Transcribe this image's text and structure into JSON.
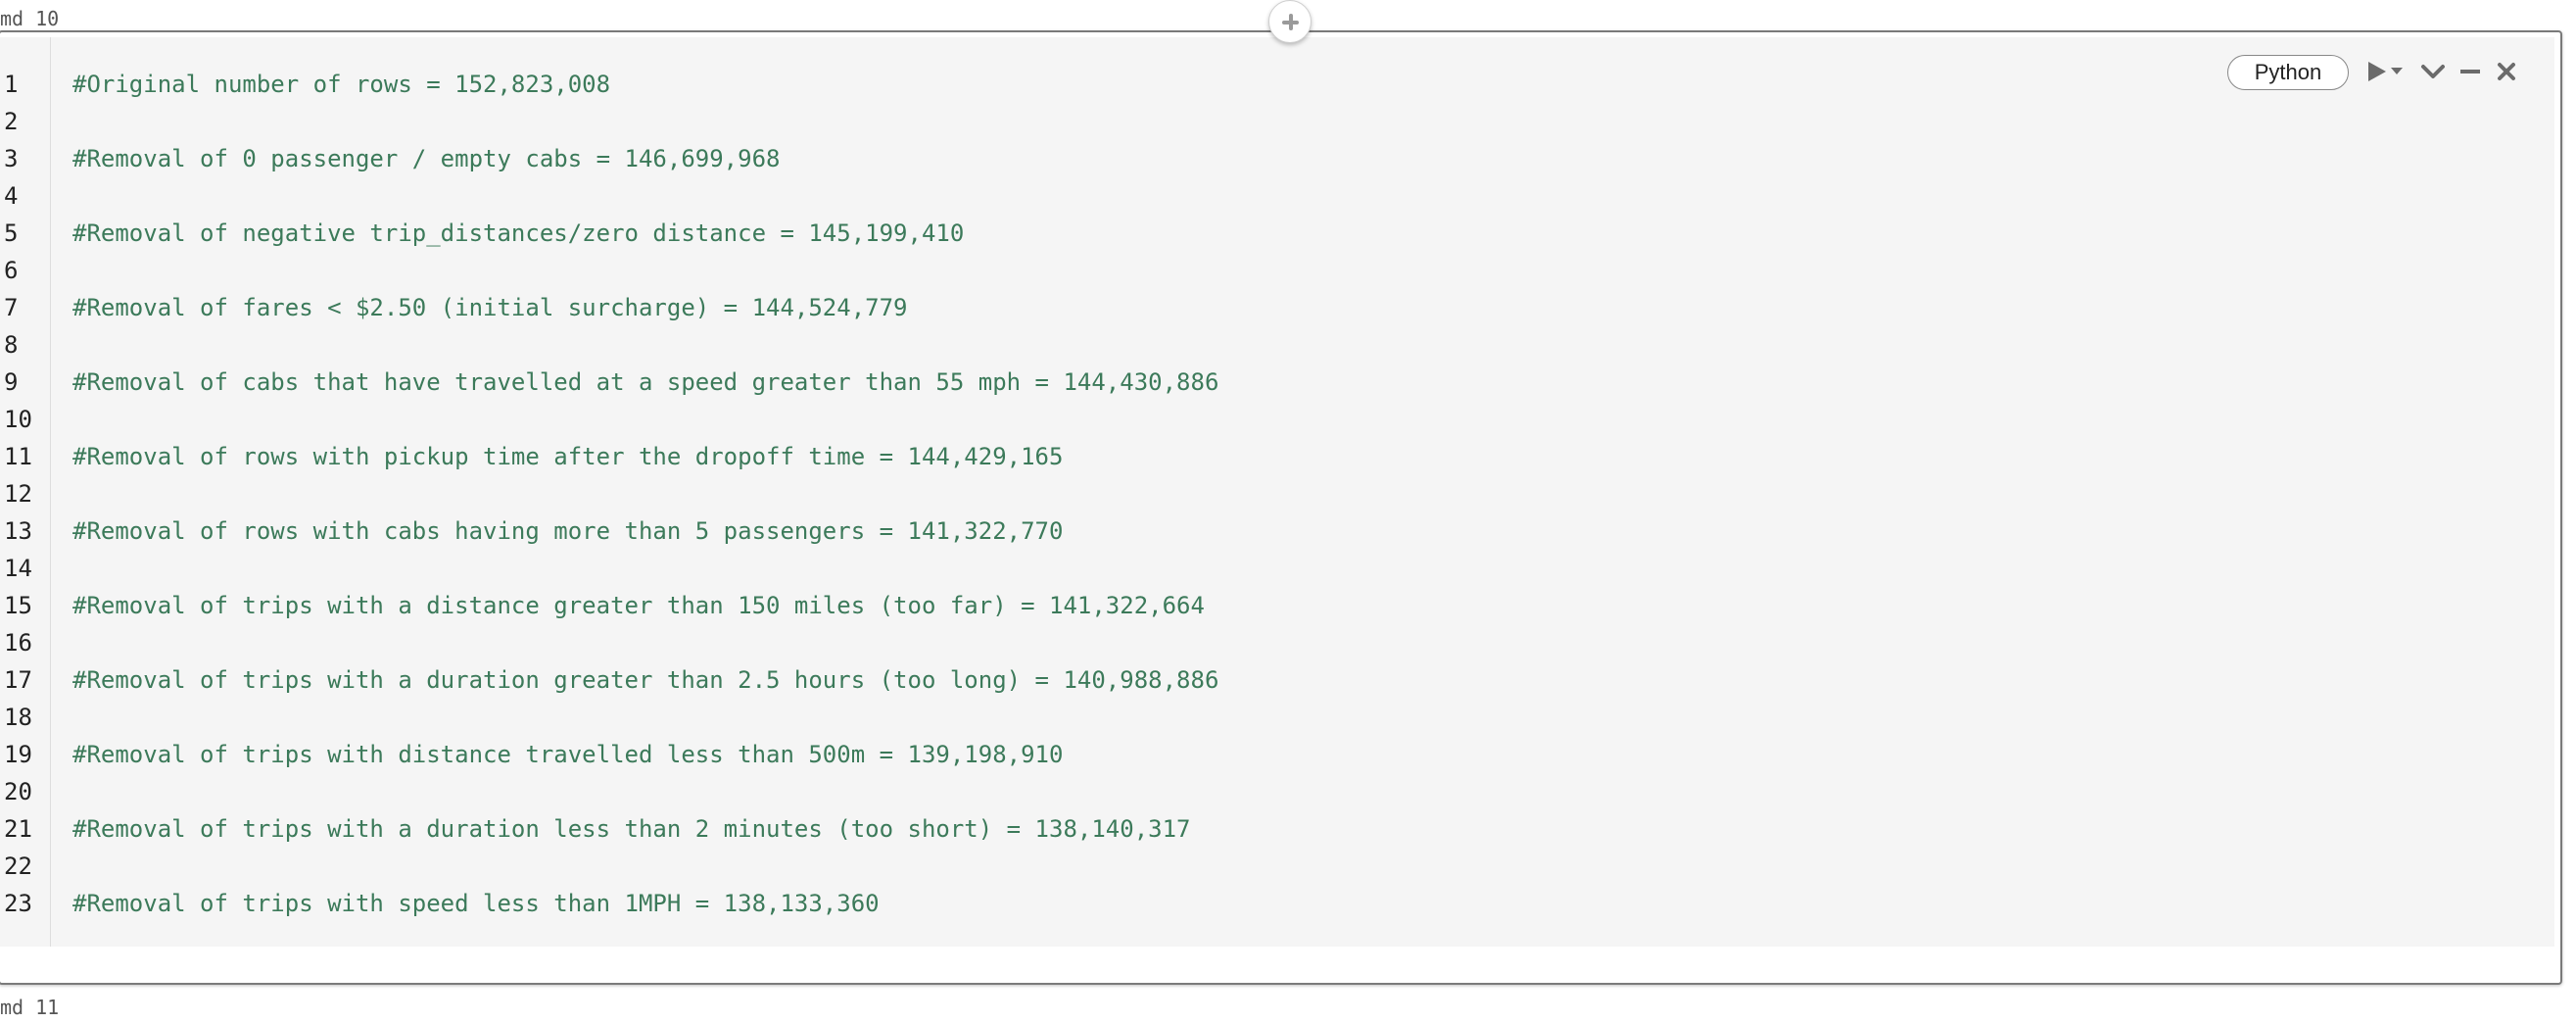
{
  "cells": {
    "top_label": "md 10",
    "bottom_label": "md 11"
  },
  "toolbar": {
    "language": "Python",
    "icons": [
      "run-icon",
      "run-menu-caret-icon",
      "collapse-chevron-icon",
      "minimize-icon",
      "close-icon"
    ]
  },
  "line_numbers": [
    "1",
    "2",
    "3",
    "4",
    "5",
    "6",
    "7",
    "8",
    "9",
    "10",
    "11",
    "12",
    "13",
    "14",
    "15",
    "16",
    "17",
    "18",
    "19",
    "20",
    "21",
    "22",
    "23"
  ],
  "code_lines": [
    "#Original number of rows = 152,823,008",
    "",
    "#Removal of 0 passenger / empty cabs = 146,699,968",
    "",
    "#Removal of negative trip_distances/zero distance = 145,199,410",
    "",
    "#Removal of fares < $2.50 (initial surcharge) = 144,524,779",
    "",
    "#Removal of cabs that have travelled at a speed greater than 55 mph = 144,430,886",
    "",
    "#Removal of rows with pickup time after the dropoff time = 144,429,165",
    "",
    "#Removal of rows with cabs having more than 5 passengers = 141,322,770",
    "",
    "#Removal of trips with a distance greater than 150 miles (too far) = 141,322,664",
    "",
    "#Removal of trips with a duration greater than 2.5 hours (too long) = 140,988,886",
    "",
    "#Removal of trips with distance travelled less than 500m = 139,198,910",
    "",
    "#Removal of trips with a duration less than 2 minutes (too short) = 138,140,317",
    "",
    "#Removal of trips with speed less than 1MPH = 138,133,360"
  ],
  "colors": {
    "comment": "#3c7a5a",
    "editor_bg": "#f5f5f5",
    "line_number": "#222222"
  }
}
